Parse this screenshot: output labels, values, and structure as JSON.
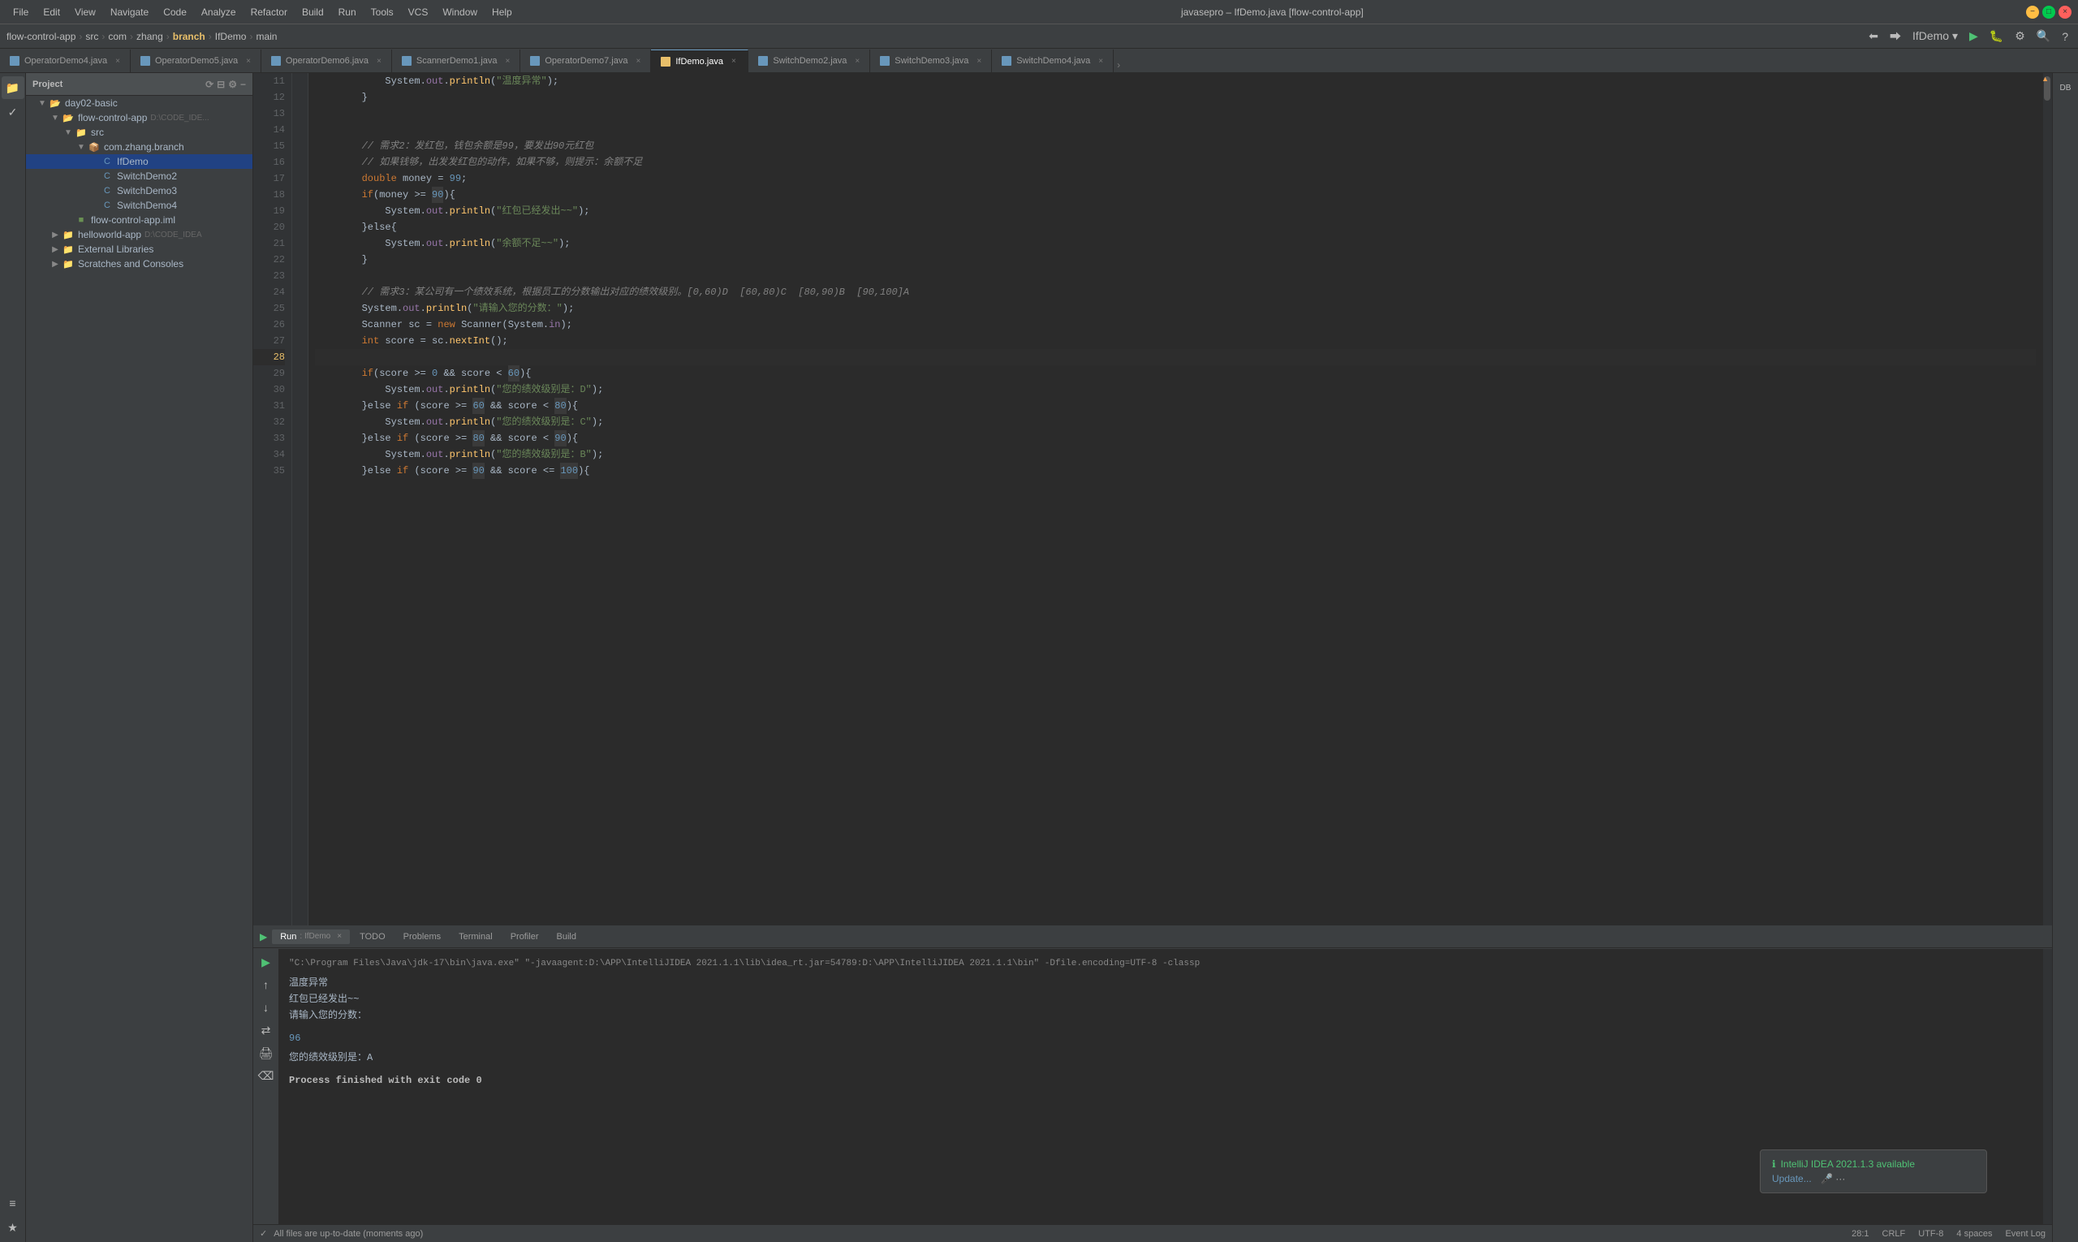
{
  "titlebar": {
    "title": "javasepro – IfDemo.java [flow-control-app]",
    "menu": [
      "File",
      "Edit",
      "View",
      "Navigate",
      "Code",
      "Analyze",
      "Refactor",
      "Build",
      "Run",
      "Tools",
      "VCS",
      "Window",
      "Help"
    ]
  },
  "breadcrumb": {
    "items": [
      "flow-control-app",
      "src",
      "com",
      "zhang",
      "branch",
      "IfDemo",
      "main"
    ]
  },
  "tabs": [
    {
      "label": "OperatorDemo4.java",
      "active": false,
      "type": "java"
    },
    {
      "label": "OperatorDemo5.java",
      "active": false,
      "type": "java"
    },
    {
      "label": "OperatorDemo6.java",
      "active": false,
      "type": "java"
    },
    {
      "label": "ScannerDemo1.java",
      "active": false,
      "type": "java"
    },
    {
      "label": "OperatorDemo7.java",
      "active": false,
      "type": "java"
    },
    {
      "label": "IfDemo.java",
      "active": true,
      "type": "java"
    },
    {
      "label": "SwitchDemo2.java",
      "active": false,
      "type": "java"
    },
    {
      "label": "SwitchDemo3.java",
      "active": false,
      "type": "java"
    },
    {
      "label": "SwitchDemo4.java",
      "active": false,
      "type": "java"
    }
  ],
  "project": {
    "title": "Project",
    "items": [
      {
        "label": "Project▾",
        "indent": 0,
        "type": "header"
      },
      {
        "label": "flow-control-app",
        "indent": 0,
        "type": "folder",
        "path": "D:\\CODE_IDEA"
      },
      {
        "label": "day02-basic",
        "indent": 1,
        "type": "folder"
      },
      {
        "label": "flow-control-app",
        "indent": 1,
        "type": "folder",
        "path": "D:\\CODE_IDEA"
      },
      {
        "label": "src",
        "indent": 2,
        "type": "folder"
      },
      {
        "label": "com.zhang.branch",
        "indent": 3,
        "type": "package"
      },
      {
        "label": "IfDemo",
        "indent": 4,
        "type": "java",
        "selected": true
      },
      {
        "label": "SwitchDemo2",
        "indent": 4,
        "type": "java"
      },
      {
        "label": "SwitchDemo3",
        "indent": 4,
        "type": "java"
      },
      {
        "label": "SwitchDemo4",
        "indent": 4,
        "type": "java"
      },
      {
        "label": "flow-control-app.iml",
        "indent": 2,
        "type": "xml"
      },
      {
        "label": "helloworld-app",
        "indent": 1,
        "type": "folder",
        "path": "D:\\CODE_IDEA"
      },
      {
        "label": "External Libraries",
        "indent": 1,
        "type": "folder"
      },
      {
        "label": "Scratches and Consoles",
        "indent": 1,
        "type": "folder"
      }
    ]
  },
  "code": {
    "lines": [
      {
        "num": 11,
        "content": "            System.out.println(\"温度异常\");",
        "type": "normal"
      },
      {
        "num": 12,
        "content": "        }",
        "type": "normal"
      },
      {
        "num": 13,
        "content": "",
        "type": "normal"
      },
      {
        "num": 14,
        "content": "",
        "type": "normal"
      },
      {
        "num": 15,
        "content": "        // 需求2：发红包，钱包余额是99，要发出90元红包",
        "type": "comment"
      },
      {
        "num": 16,
        "content": "        // 如果钱够，出发发红包的动作，如果不够，则提示：余额不足",
        "type": "comment"
      },
      {
        "num": 17,
        "content": "        double money = 99;",
        "type": "normal"
      },
      {
        "num": 18,
        "content": "        if(money >= 90){",
        "type": "normal"
      },
      {
        "num": 19,
        "content": "            System.out.println(\"红包已经发出~~\");",
        "type": "normal"
      },
      {
        "num": 20,
        "content": "        }else{",
        "type": "normal"
      },
      {
        "num": 21,
        "content": "            System.out.println(\"余额不足~~\");",
        "type": "normal"
      },
      {
        "num": 22,
        "content": "        }",
        "type": "normal"
      },
      {
        "num": 23,
        "content": "",
        "type": "normal"
      },
      {
        "num": 24,
        "content": "        // 需求3：某公司有一个绩效系统，根据员工的分数输出对应的绩效级别。[0,60)D  [60,80)C  [80,90)B  [90,100]A",
        "type": "comment"
      },
      {
        "num": 25,
        "content": "        System.out.println(\"请输入您的分数：\");",
        "type": "normal"
      },
      {
        "num": 26,
        "content": "        Scanner sc = new Scanner(System.in);",
        "type": "normal"
      },
      {
        "num": 27,
        "content": "        int score = sc.nextInt();",
        "type": "normal"
      },
      {
        "num": 28,
        "content": "",
        "type": "active"
      },
      {
        "num": 29,
        "content": "        if(score >= 0 && score < 60){",
        "type": "normal"
      },
      {
        "num": 30,
        "content": "            System.out.println(\"您的绩效级别是：D\");",
        "type": "normal"
      },
      {
        "num": 31,
        "content": "        }else if (score >= 60 && score < 80){",
        "type": "normal"
      },
      {
        "num": 32,
        "content": "            System.out.println(\"您的绩效级别是：C\");",
        "type": "normal"
      },
      {
        "num": 33,
        "content": "        }else if (score >= 80 && score < 90){",
        "type": "normal"
      },
      {
        "num": 34,
        "content": "            System.out.println(\"您的绩效级别是：B\");",
        "type": "normal"
      },
      {
        "num": 35,
        "content": "        }else if (score >= 90 && score <= 100){",
        "type": "normal"
      }
    ]
  },
  "run": {
    "tab_label": "IfDemo",
    "cmd": "\"C:\\Program Files\\Java\\jdk-17\\bin\\java.exe\" \"-javaagent:D:\\APP\\IntelliJIDEA 2021.1.1\\lib\\idea_rt.jar=54789:D:\\APP\\IntelliJIDEA 2021.1.1\\bin\" -Dfile.encoding=UTF-8 -classp",
    "output": [
      "温度异常",
      "红包已经发出~~",
      "请输入您的分数："
    ],
    "input": "96",
    "result": "您的绩效级别是：A",
    "process": "Process finished with exit code 0"
  },
  "status": {
    "left": "All files are up-to-date (moments ago)",
    "line_col": "28:1",
    "crlf": "CRLF",
    "encoding": "UTF-8",
    "indent": "4 spaces"
  },
  "bottom_tabs": [
    {
      "label": "Run",
      "active": true
    },
    {
      "label": "TODO"
    },
    {
      "label": "Problems"
    },
    {
      "label": "Terminal"
    },
    {
      "label": "Profiler"
    },
    {
      "label": "Build"
    }
  ],
  "notification": {
    "title": "IntelliJ IDEA 2021.1.3 available",
    "link": "Update..."
  }
}
